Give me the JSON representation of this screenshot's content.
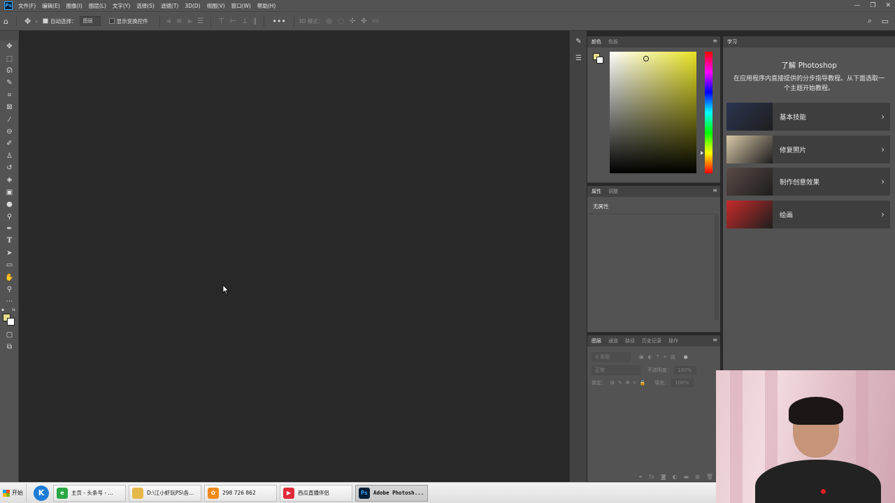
{
  "app": {
    "logo_text": "Ps"
  },
  "menu": [
    "文件(F)",
    "编辑(E)",
    "图像(I)",
    "图层(L)",
    "文字(Y)",
    "选择(S)",
    "滤镜(T)",
    "3D(D)",
    "视图(V)",
    "窗口(W)",
    "帮助(H)"
  ],
  "window_controls": {
    "minimize": "—",
    "restore": "❐",
    "close": "✕"
  },
  "options_bar": {
    "auto_select_label": "自动选择：",
    "auto_select_value": "图层",
    "show_transform_label": "显示变换控件",
    "mode_3d_label": "3D 模式："
  },
  "colors": {
    "foreground": "#e6df8e",
    "background": "#ffffff",
    "hue": "#e8e225"
  },
  "panels": {
    "color": {
      "tabs": [
        "颜色",
        "色板"
      ]
    },
    "properties": {
      "tabs": [
        "属性",
        "调整"
      ],
      "empty_text": "无属性"
    },
    "layers": {
      "tabs": [
        "图层",
        "通道",
        "路径",
        "历史记录",
        "操作"
      ],
      "filter_placeholder": "类型",
      "blend_mode": "正常",
      "opacity_label": "不透明度：",
      "opacity_value": "100%",
      "lock_label": "锁定：",
      "fill_label": "填充：",
      "fill_value": "100%"
    }
  },
  "learn": {
    "tab": "学习",
    "title": "了解 Photoshop",
    "description": "在应用程序内直接提供的分步指导教程。从下面选取一个主题开始教程。",
    "cards": [
      {
        "label": "基本技能",
        "thumb_color": "#2a3550"
      },
      {
        "label": "修复照片",
        "thumb_color": "#d9c9a8"
      },
      {
        "label": "制作创意效果",
        "thumb_color": "#5a4a46"
      },
      {
        "label": "绘画",
        "thumb_color": "#c92a2a"
      }
    ]
  },
  "taskbar": {
    "start": "开始",
    "items": [
      {
        "label": "主页 - 头条号 - ...",
        "icon_color": "#2aa845"
      },
      {
        "label": "D:\\江小虾玩PS\\各...",
        "icon_color": "#e5b84a"
      },
      {
        "label": "298 726 862",
        "icon_color": "#f28a1a"
      },
      {
        "label": "西瓜直播伴侣",
        "icon_color": "#e02a3a"
      },
      {
        "label": "Adobe Photosh...",
        "icon_color": "#001e36",
        "active": true
      }
    ]
  }
}
